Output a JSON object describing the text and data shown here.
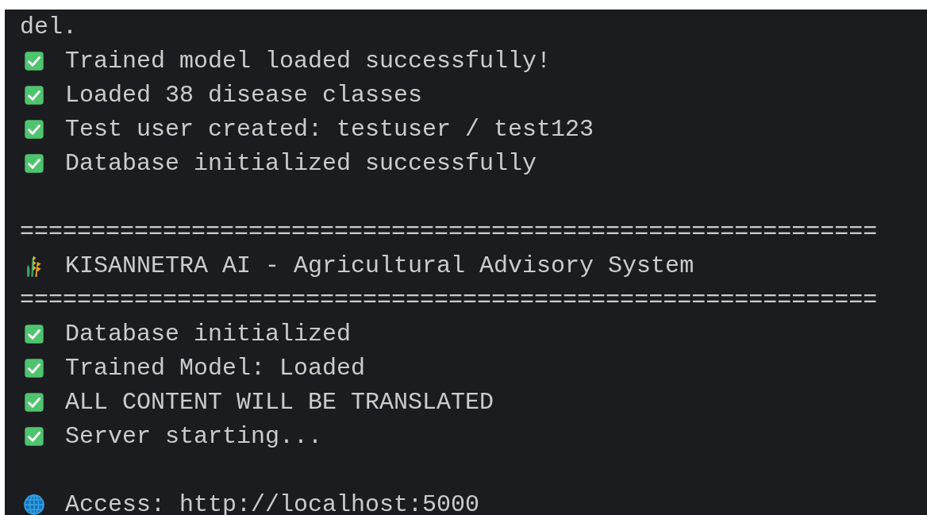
{
  "terminal": {
    "lines": [
      {
        "kind": "plain",
        "text": "del."
      },
      {
        "kind": "check",
        "text": "Trained model loaded successfully!"
      },
      {
        "kind": "check",
        "text": "Loaded 38 disease classes"
      },
      {
        "kind": "check",
        "text": "Test user created: testuser / test123"
      },
      {
        "kind": "check",
        "text": "Database initialized successfully"
      },
      {
        "kind": "blank"
      },
      {
        "kind": "plain",
        "text": "============================================================"
      },
      {
        "kind": "wheat",
        "text": "KISANNETRA AI - Agricultural Advisory System"
      },
      {
        "kind": "plain",
        "text": "============================================================"
      },
      {
        "kind": "check",
        "text": "Database initialized"
      },
      {
        "kind": "check",
        "text": "Trained Model: Loaded"
      },
      {
        "kind": "check",
        "text": "ALL CONTENT WILL BE TRANSLATED"
      },
      {
        "kind": "check",
        "text": "Server starting..."
      },
      {
        "kind": "blank"
      },
      {
        "kind": "globe",
        "text": "Access: http://localhost:5000"
      }
    ]
  }
}
